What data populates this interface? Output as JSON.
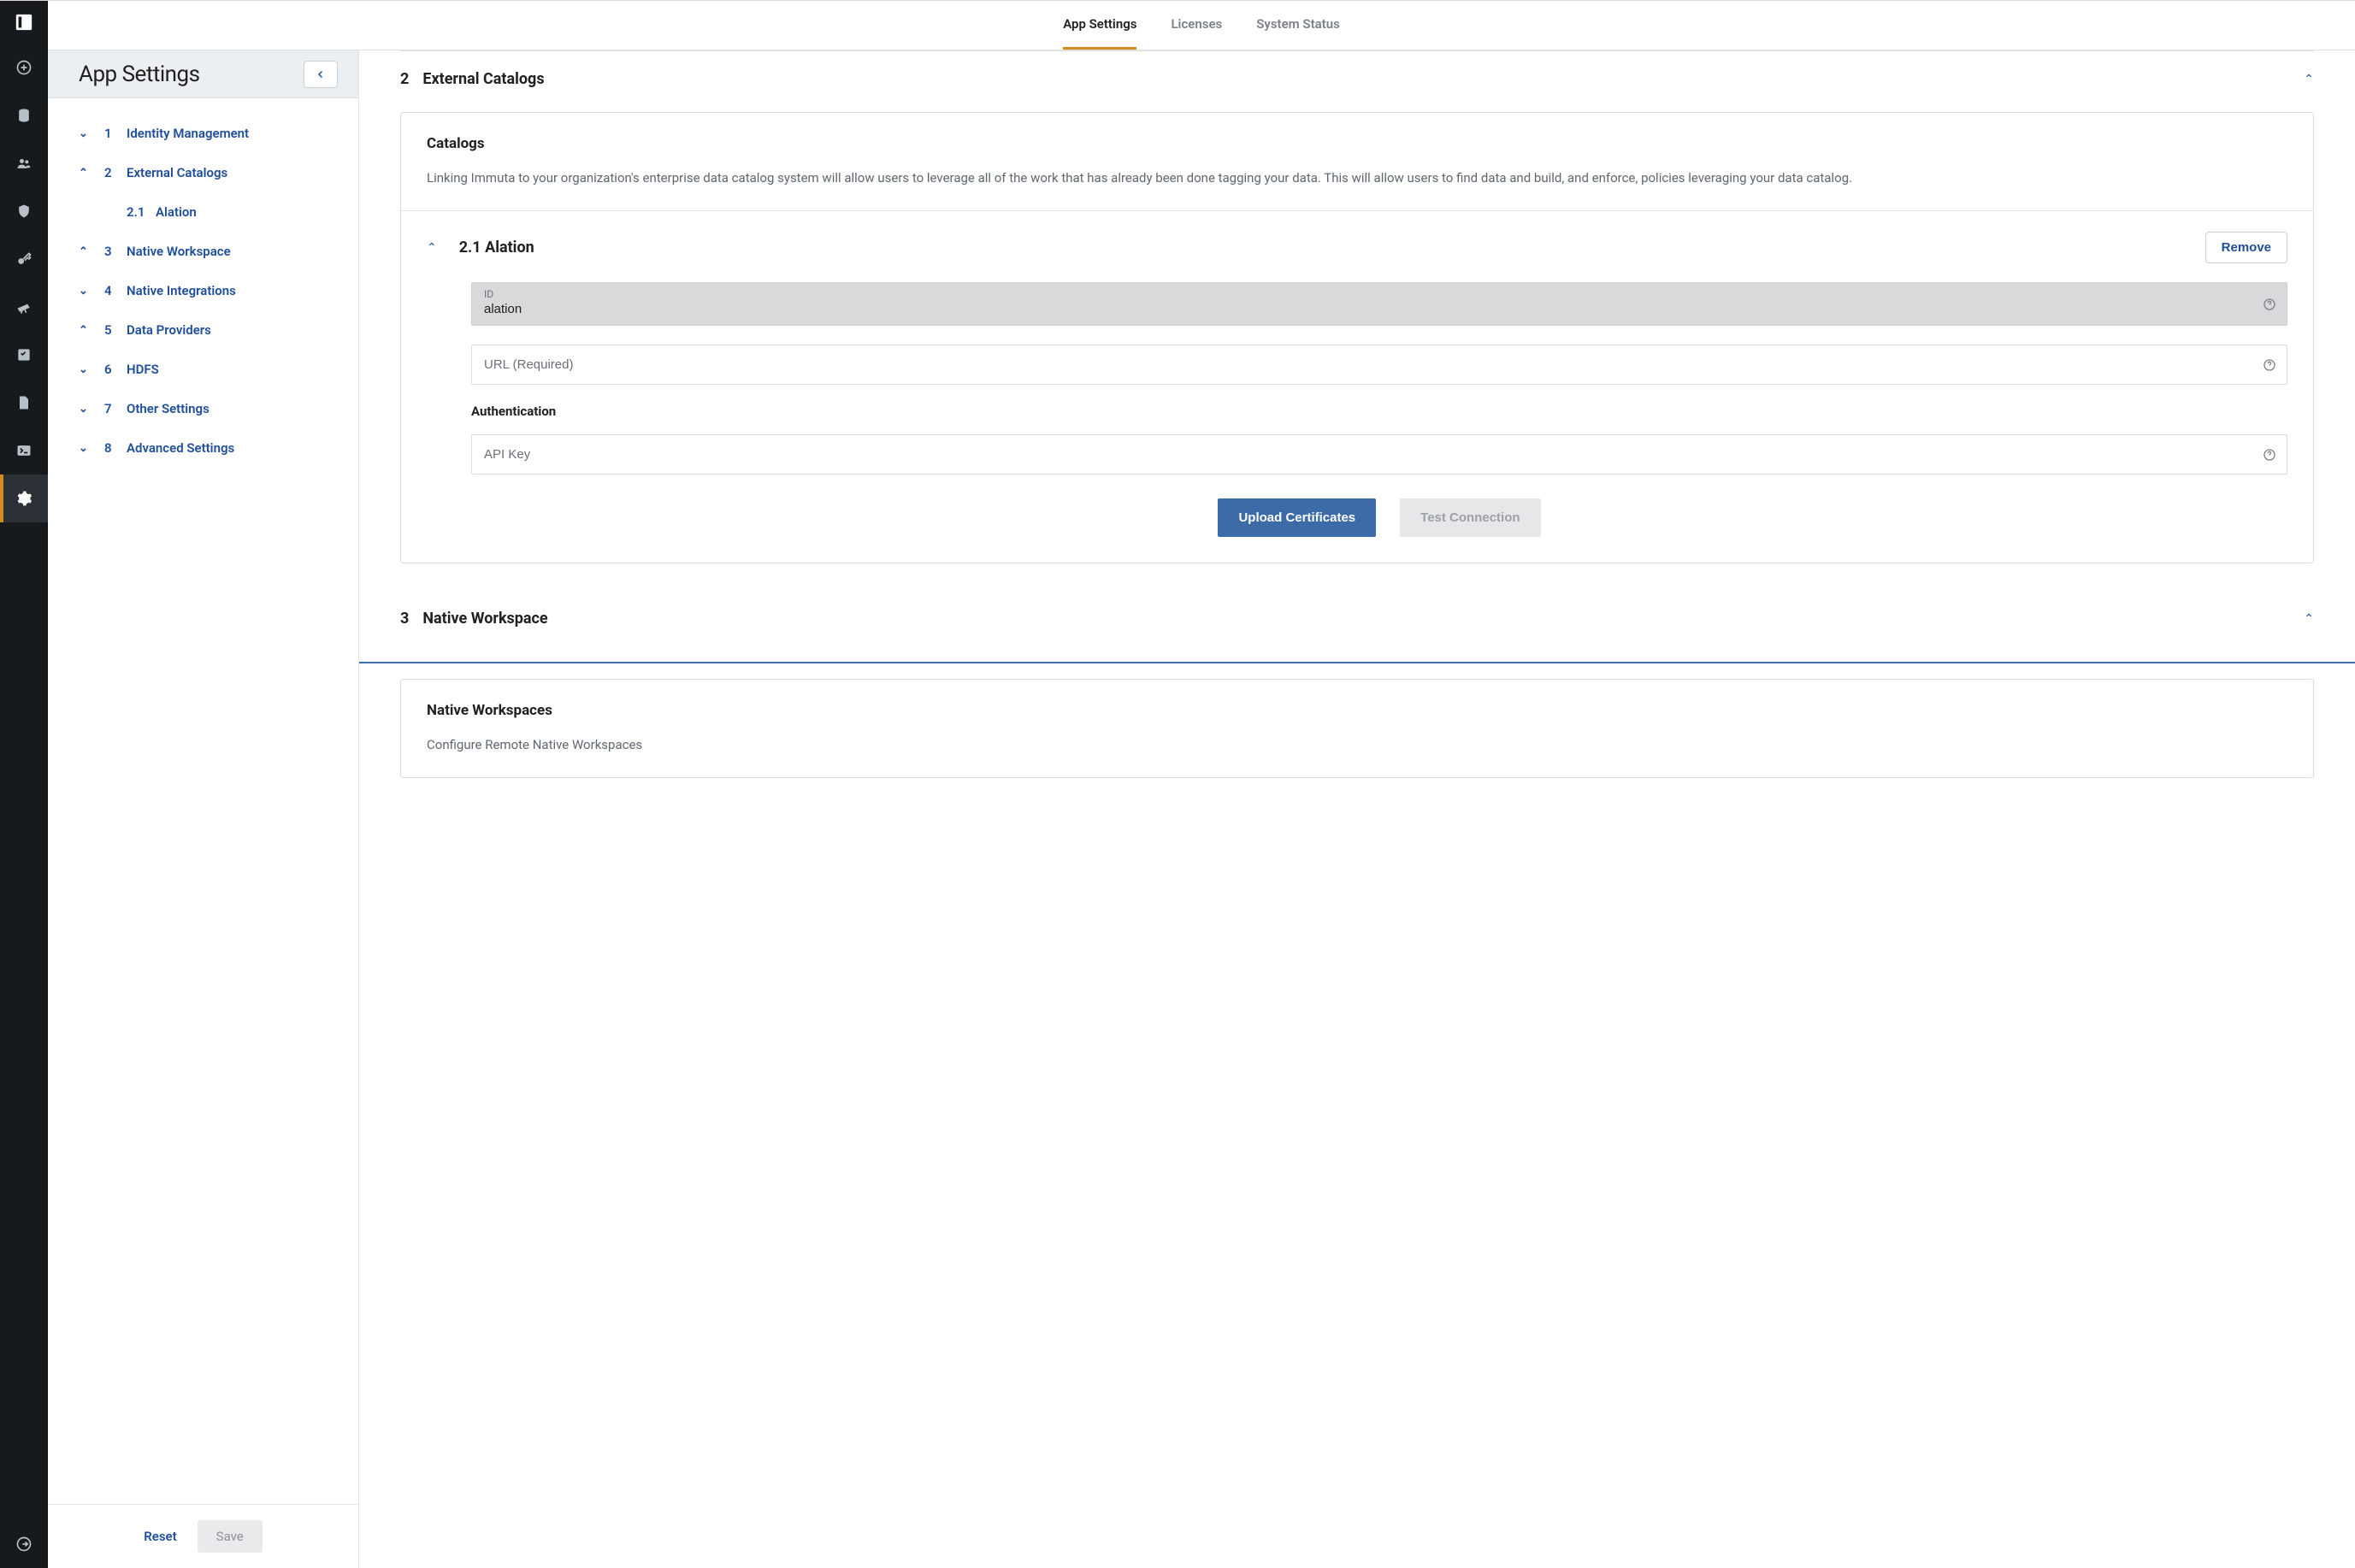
{
  "tabs": {
    "app_settings": "App Settings",
    "licenses": "Licenses",
    "system_status": "System Status"
  },
  "sidebar": {
    "title": "App Settings",
    "items": [
      {
        "num": "1",
        "label": "Identity Management",
        "expanded": false
      },
      {
        "num": "2",
        "label": "External Catalogs",
        "expanded": true
      },
      {
        "num": "3",
        "label": "Native Workspace",
        "expanded": true
      },
      {
        "num": "4",
        "label": "Native Integrations",
        "expanded": false
      },
      {
        "num": "5",
        "label": "Data Providers",
        "expanded": true
      },
      {
        "num": "6",
        "label": "HDFS",
        "expanded": false
      },
      {
        "num": "7",
        "label": "Other Settings",
        "expanded": false
      },
      {
        "num": "8",
        "label": "Advanced Settings",
        "expanded": false
      }
    ],
    "sub_item": {
      "num": "2.1",
      "label": "Alation"
    },
    "reset": "Reset",
    "save": "Save"
  },
  "sections": {
    "ext": {
      "num": "2",
      "name": "External Catalogs"
    },
    "nw": {
      "num": "3",
      "name": "Native Workspace"
    }
  },
  "catalogs_card": {
    "title": "Catalogs",
    "desc": "Linking Immuta to your organization's enterprise data catalog system will allow users to leverage all of the work that has already been done tagging your data. This will allow users to find data and build, and enforce, policies leveraging your data catalog."
  },
  "alation": {
    "num": "2.1",
    "name": "Alation",
    "remove": "Remove",
    "id_label": "ID",
    "id_value": "alation",
    "url_label": "URL (Required)",
    "url_value": "",
    "auth_title": "Authentication",
    "api_key_label": "API Key",
    "api_key_value": "",
    "upload_btn": "Upload Certificates",
    "test_btn": "Test Connection"
  },
  "native_card": {
    "title": "Native Workspaces",
    "desc": "Configure Remote Native Workspaces"
  }
}
